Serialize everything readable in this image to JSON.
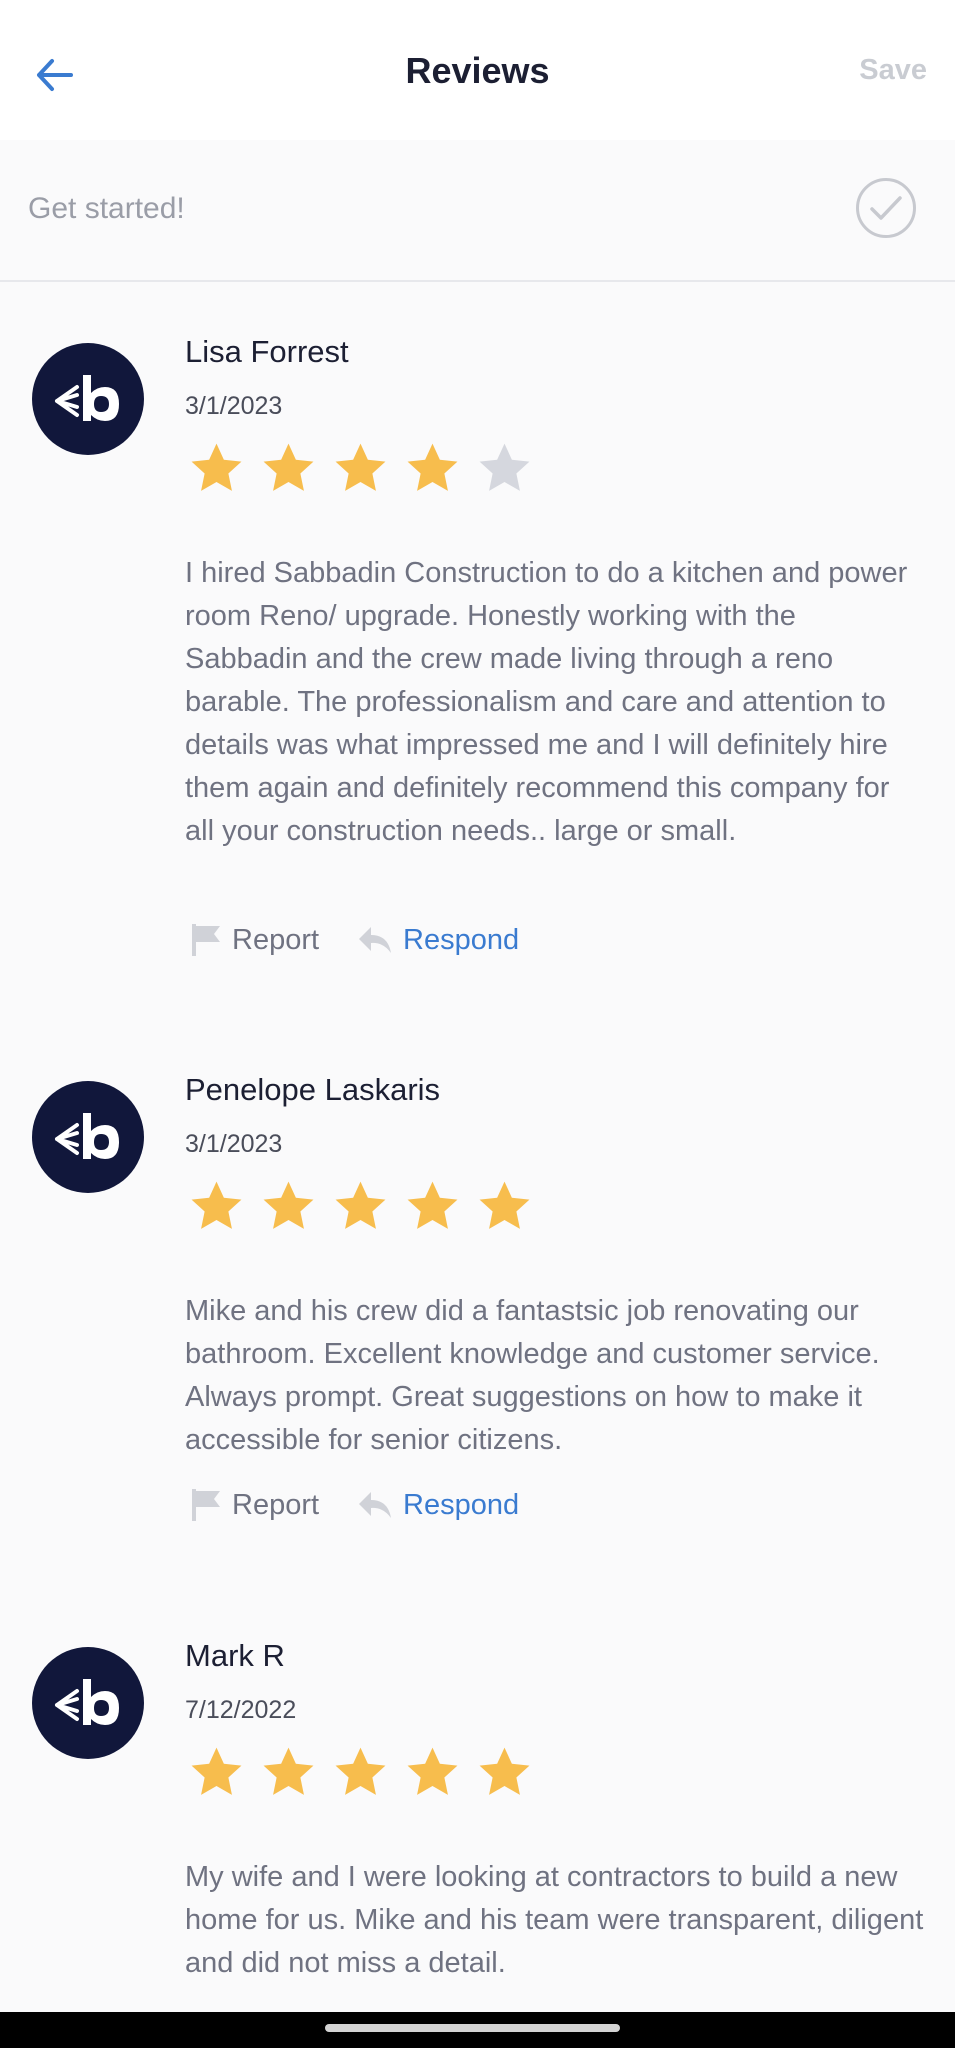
{
  "header": {
    "title": "Reviews",
    "save_label": "Save"
  },
  "banner": {
    "label": "Get started!"
  },
  "colors": {
    "accent": "#3a7bd0",
    "star_filled": "#f7bd4d",
    "star_empty": "#d5d7de",
    "avatar_bg": "#11173b"
  },
  "actions": {
    "report_label": "Report",
    "respond_label": "Respond"
  },
  "reviews": [
    {
      "name": "Lisa Forrest",
      "date": "3/1/2023",
      "rating": 4,
      "max_rating": 5,
      "text": "I hired Sabbadin Construction to do a  kitchen and power room Reno/ upgrade. Honestly working with the Sabbadin and the crew made living through a reno barable. The professionalism and care and attention to details was what impressed me and I will definitely hire them again and definitely recommend this company for all your construction needs.. large or small."
    },
    {
      "name": "Penelope Laskaris",
      "date": "3/1/2023",
      "rating": 5,
      "max_rating": 5,
      "text": "Mike and his crew did a fantastsic job renovating our bathroom.  Excellent knowledge and customer service.  Always prompt.  Great suggestions on how to make it accessible for senior citizens."
    },
    {
      "name": "Mark R",
      "date": "7/12/2022",
      "rating": 5,
      "max_rating": 5,
      "text": "My wife and I were looking at contractors to build a new home for us. Mike and his team were transparent, diligent and did not miss a detail."
    }
  ]
}
